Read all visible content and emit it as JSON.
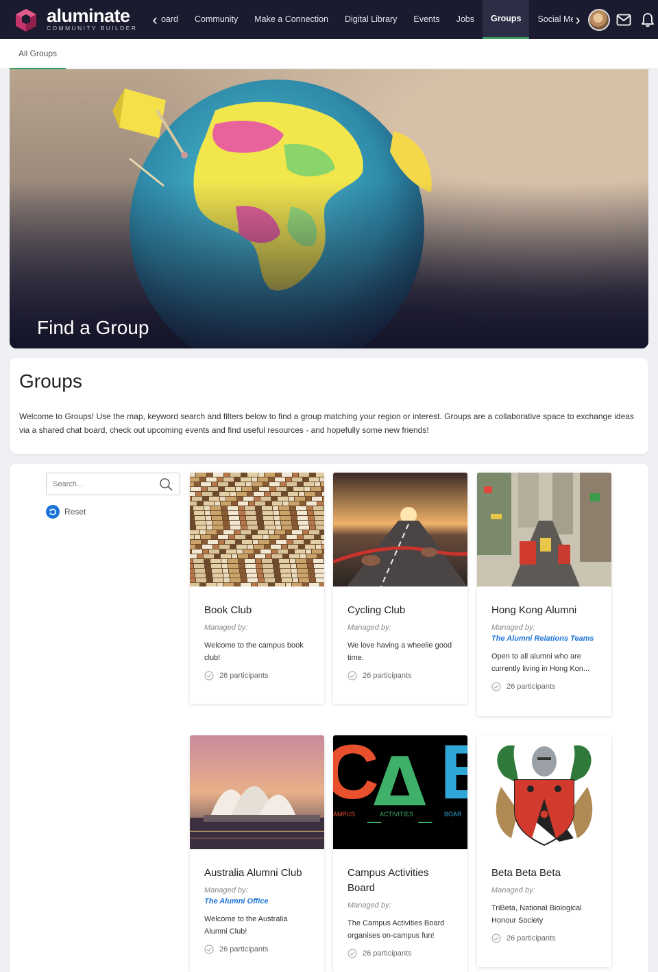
{
  "app": {
    "logo_word": "aluminate",
    "logo_sub": "COMMUNITY BUILDER"
  },
  "nav": {
    "items": [
      {
        "label": "oard"
      },
      {
        "label": "Community"
      },
      {
        "label": "Make a Connection"
      },
      {
        "label": "Digital Library"
      },
      {
        "label": "Events"
      },
      {
        "label": "Jobs"
      },
      {
        "label": "Groups"
      },
      {
        "label": "Social Me"
      }
    ],
    "active": "Groups"
  },
  "subnav": {
    "tab": "All Groups"
  },
  "hero": {
    "title": "Find a Group"
  },
  "intro": {
    "title": "Groups",
    "description": "Welcome to Groups! Use the map, keyword search and filters below to find a group matching your region or interest. Groups are a collaborative space to exchange ideas via a shared chat board, check out upcoming events and find useful resources - and hopefully some new friends!"
  },
  "filters": {
    "search_placeholder": "Search...",
    "reset_label": "Reset"
  },
  "groups": [
    {
      "name": "Book Club",
      "managed_by_label": "Managed by:",
      "manager": "",
      "description": "Welcome to the campus book club!",
      "participants": "26 participants"
    },
    {
      "name": "Cycling Club",
      "managed_by_label": "Managed by:",
      "manager": "",
      "description": "We love having a wheelie good time.",
      "participants": "26 participants"
    },
    {
      "name": "Hong Kong Alumni",
      "managed_by_label": "Managed by:",
      "manager": "The Alumni Relations Teams",
      "description": "Open to all alumni who are currently living in Hong Kon...",
      "participants": "26 participants"
    },
    {
      "name": "Australia Alumni Club",
      "managed_by_label": "Managed by:",
      "manager": "The Alumni Office",
      "description": "Welcome to the Australia Alumni Club!",
      "participants": "26 participants"
    },
    {
      "name": "Campus Activities Board",
      "managed_by_label": "Managed by:",
      "manager": "",
      "description": "The Campus Activities Board organises on-campus fun!",
      "participants": "26 participants"
    },
    {
      "name": "Beta Beta Beta",
      "managed_by_label": "Managed by:",
      "manager": "",
      "description": "TriBeta, National Biological Honour Society",
      "participants": "26 participants"
    }
  ],
  "cab_logo": {
    "letters": [
      "C",
      "A",
      "B"
    ],
    "words": [
      "AMPUS",
      "ACTIVITIES",
      "BOAR"
    ]
  },
  "colors": {
    "nav_bg": "#1b1b2f",
    "accent_green": "#3c9a5f",
    "link_blue": "#1d74d8",
    "logo_pink": "#c2336a"
  }
}
